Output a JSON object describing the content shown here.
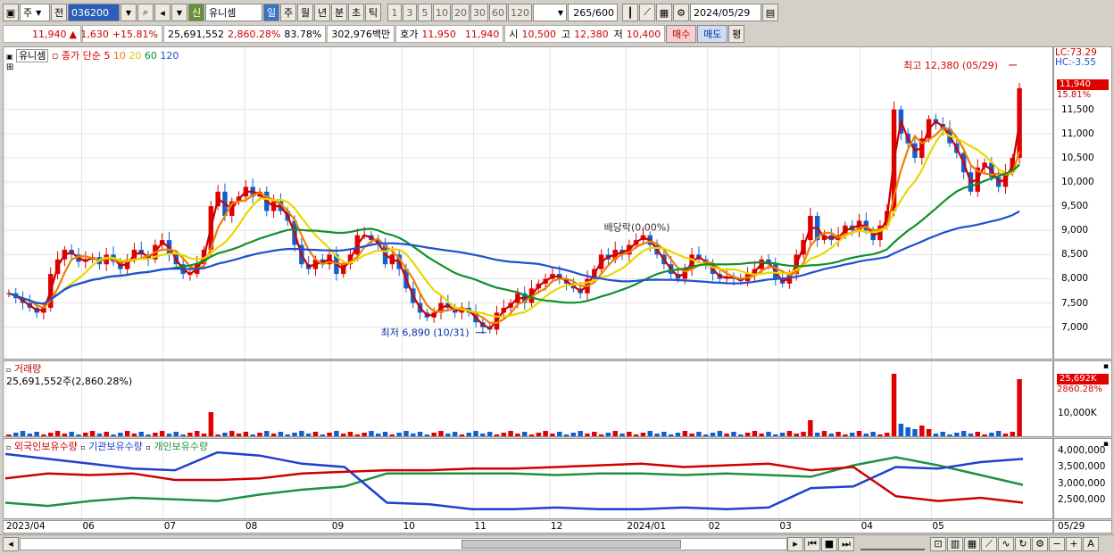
{
  "toolbar": {
    "market": "주",
    "prev_label": "전",
    "code": "036200",
    "new_badge": "신",
    "name": "유니셈",
    "periods": [
      "일",
      "주",
      "월",
      "년",
      "분",
      "초",
      "틱"
    ],
    "minutes": [
      "1",
      "3",
      "5",
      "10",
      "20",
      "30",
      "60",
      "120"
    ],
    "count": "265",
    "count_total": "/600",
    "date": "2024/05/29"
  },
  "quote": {
    "price": "11,940",
    "change": "1,630",
    "change_pct": "+15.81%",
    "volume": "25,691,552",
    "volume_pct": "2,860.28%",
    "turnover_pct": "83.78%",
    "amount": "302,976백만",
    "ask_label": "호가",
    "ask": "11,950",
    "bid": "11,940",
    "open_label": "시",
    "open": "10,500",
    "high_label": "고",
    "high": "12,380",
    "low_label": "저",
    "low": "10,400",
    "buy_label": "매수",
    "sell_label": "매도",
    "eval_label": "평"
  },
  "price_panel": {
    "stock": "유니셈",
    "legend_prefix": "종가 단순",
    "ma": [
      {
        "label": "5",
        "color": "#d00000"
      },
      {
        "label": "10",
        "color": "#f08000"
      },
      {
        "label": "20",
        "color": "#e8d800"
      },
      {
        "label": "60",
        "color": "#10902a"
      },
      {
        "label": "120",
        "color": "#2050d0"
      }
    ],
    "lc": "LC:73.29",
    "hc": "HC:-3.55",
    "high_note": "최고 12,380 (05/29)",
    "low_note": "최저 6,890 (10/31)",
    "dividend_note": "배당락(0.00%)",
    "last_price_tag": "11,940",
    "last_pct_tag": "15.81%",
    "y_ticks": [
      "11,500",
      "11,000",
      "10,500",
      "10,000",
      "9,500",
      "9,000",
      "8,500",
      "8,000",
      "7,500",
      "7,000"
    ]
  },
  "volume_panel": {
    "title": "거래량",
    "value": "25,691,552주(2,860.28%)",
    "tag_value": "25,692K",
    "tag_pct": "2860.28%",
    "y_tick": "10,000K"
  },
  "holding_panel": {
    "legends": [
      {
        "label": "외국인보유수량",
        "color": "#d00000"
      },
      {
        "label": "기관보유수량",
        "color": "#2040d0"
      },
      {
        "label": "개인보유수량",
        "color": "#209040"
      }
    ],
    "y_ticks": [
      "4,000,000",
      "3,500,000",
      "3,000,000",
      "2,500,000"
    ]
  },
  "x_axis": {
    "labels": [
      "2023/04",
      "06",
      "07",
      "08",
      "09",
      "10",
      "11",
      "12",
      "2024/01",
      "02",
      "03",
      "04",
      "05"
    ],
    "end_label": "05/29"
  },
  "chart_data": {
    "type": "candlestick",
    "title": "유니셈",
    "period": "daily",
    "date_range": [
      "2023/04",
      "2024/05/29"
    ],
    "close_series_approx": [
      7700,
      7600,
      7500,
      7400,
      7300,
      7400,
      8100,
      8400,
      8600,
      8500,
      8350,
      8400,
      8450,
      8300,
      8500,
      8350,
      8200,
      8400,
      8600,
      8500,
      8400,
      8700,
      8800,
      8500,
      8300,
      8100,
      8100,
      8300,
      8600,
      9500,
      9800,
      9300,
      9600,
      9700,
      9900,
      9700,
      9800,
      9400,
      9600,
      9400,
      9200,
      8700,
      8300,
      8200,
      8400,
      8300,
      8500,
      8100,
      8300,
      8500,
      8900,
      8900,
      8800,
      8700,
      8300,
      8500,
      8200,
      7800,
      7500,
      7300,
      7200,
      7300,
      7500,
      7400,
      7300,
      7400,
      7300,
      7100,
      7000,
      6950,
      7300,
      7400,
      7500,
      7700,
      7500,
      7800,
      7900,
      8000,
      8100,
      8000,
      7900,
      7800,
      7700,
      8000,
      8200,
      8500,
      8400,
      8600,
      8500,
      8700,
      8800,
      8900,
      8700,
      8500,
      8300,
      8100,
      8000,
      8200,
      8500,
      8400,
      8300,
      8100,
      8000,
      8050,
      8000,
      7950,
      8100,
      8200,
      8400,
      8300,
      8000,
      7900,
      8100,
      8500,
      8800,
      9300,
      8800,
      8900,
      8800,
      8900,
      9100,
      9000,
      9200,
      9000,
      8800,
      9100,
      9400,
      11500,
      11000,
      10800,
      10500,
      10900,
      11300,
      11200,
      11100,
      10800,
      10600,
      10200,
      9800,
      10300,
      10400,
      10100,
      9900,
      10200,
      10500,
      11940
    ],
    "moving_averages": [
      "5",
      "10",
      "20",
      "60",
      "120"
    ],
    "annotations": {
      "high": {
        "label": "최고 12,380 (05/29)",
        "value": 12380
      },
      "low": {
        "label": "최저 6,890 (10/31)",
        "value": 6890
      },
      "dividend": {
        "label": "배당락(0.00%)"
      }
    },
    "last": {
      "price": 11940,
      "change_pct": 15.81
    },
    "ylim": [
      6700,
      12600
    ],
    "volume_last": 25691552,
    "holding_series": [
      "외국인보유수량",
      "기관보유수량",
      "개인보유수량"
    ],
    "holding_ylim": [
      2000000,
      4200000
    ]
  }
}
